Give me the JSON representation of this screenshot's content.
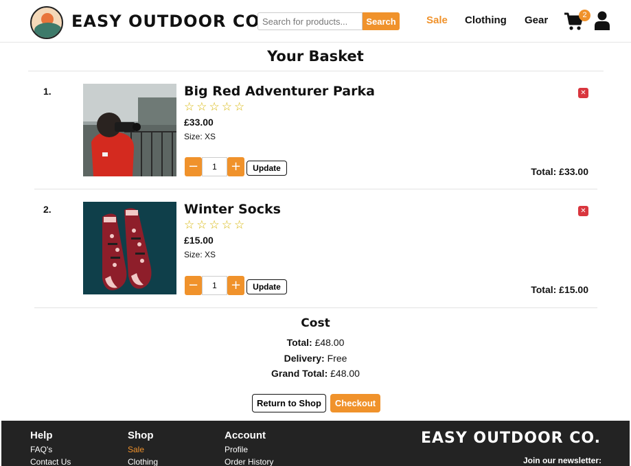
{
  "header": {
    "brand": "EASY OUTDOOR CO.",
    "search_placeholder": "Search for products...",
    "search_button": "Search",
    "nav": [
      "Sale",
      "Clothing",
      "Gear"
    ],
    "cart_count": "2"
  },
  "basket": {
    "title": "Your Basket",
    "items": [
      {
        "number": "1.",
        "name": "Big Red Adventurer Parka",
        "stars": "☆☆☆☆☆",
        "price": "£33.00",
        "size": "Size: XS",
        "quantity": "1",
        "minus": "−",
        "plus": "+",
        "update": "Update",
        "remove": "✕",
        "total": "Total: £33.00"
      },
      {
        "number": "2.",
        "name": "Winter Socks",
        "stars": "☆☆☆☆☆",
        "price": "£15.00",
        "size": "Size: XS",
        "quantity": "1",
        "minus": "−",
        "plus": "+",
        "update": "Update",
        "remove": "✕",
        "total": "Total: £15.00"
      }
    ]
  },
  "cost": {
    "title": "Cost",
    "total_label": "Total:",
    "total_value": "£48.00",
    "delivery_label": "Delivery:",
    "delivery_value": "Free",
    "grand_label": "Grand Total:",
    "grand_value": "£48.00",
    "return_button": "Return to Shop",
    "checkout_button": "Checkout"
  },
  "footer": {
    "help": {
      "title": "Help",
      "links": [
        "FAQ's",
        "Contact Us"
      ]
    },
    "shop": {
      "title": "Shop",
      "links": [
        "Sale",
        "Clothing"
      ]
    },
    "account": {
      "title": "Account",
      "links": [
        "Profile",
        "Order History"
      ]
    },
    "brand": "EASY OUTDOOR CO.",
    "newsletter": "Join our newsletter:"
  },
  "colors": {
    "accent": "#f0922b",
    "remove": "#d9363e",
    "footer_bg": "#232323"
  }
}
